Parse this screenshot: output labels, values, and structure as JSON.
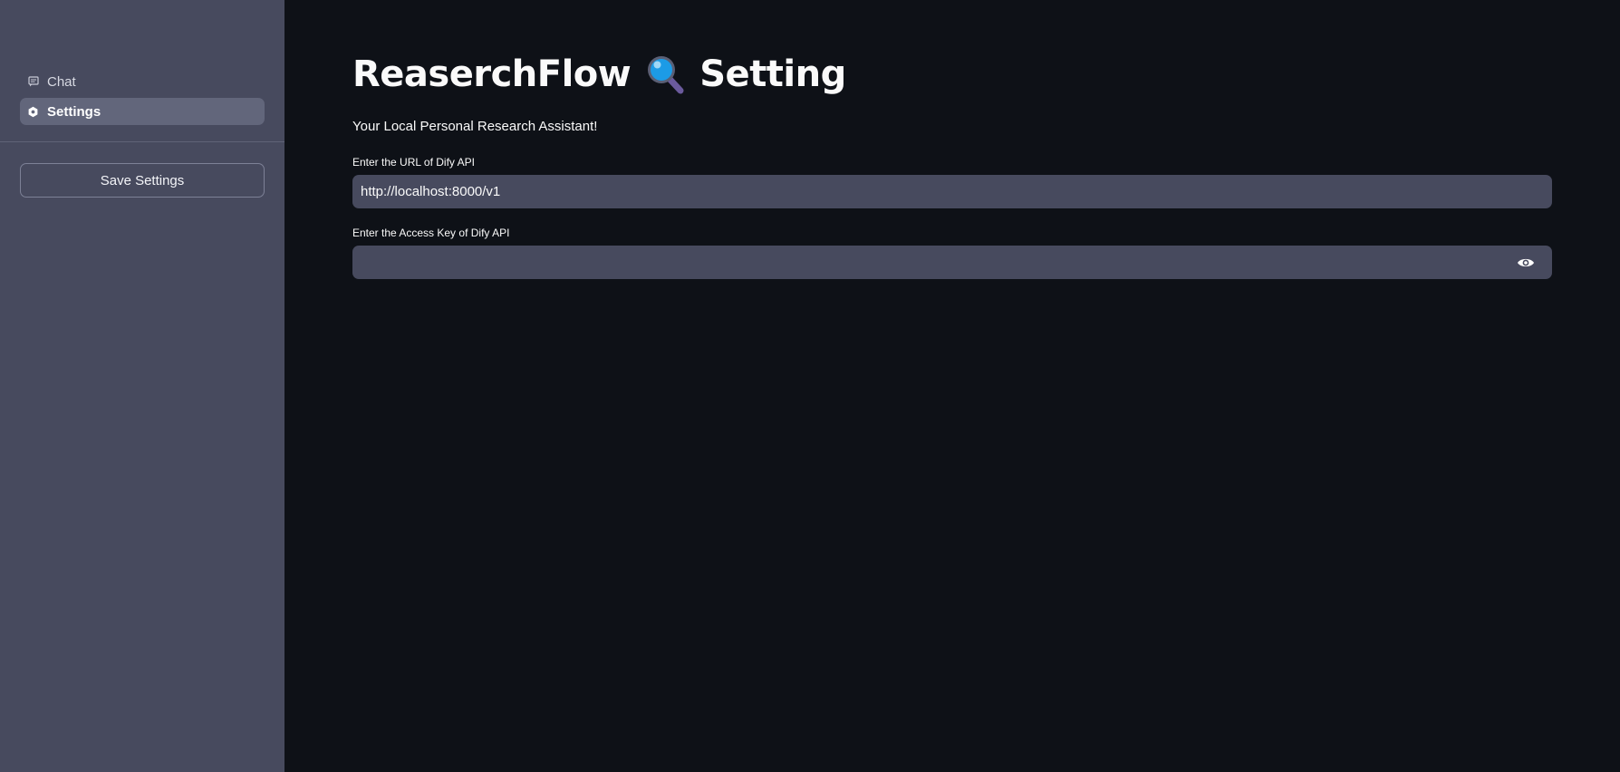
{
  "sidebar": {
    "items": [
      {
        "label": "Chat",
        "icon": "chat-icon",
        "active": false
      },
      {
        "label": "Settings",
        "icon": "settings-gear-icon",
        "active": true
      }
    ],
    "save_button_label": "Save Settings"
  },
  "main": {
    "title_part1": "ReaserchFlow",
    "title_icon": "magnifier-icon",
    "title_part2": "Setting",
    "subtitle": "Your Local Personal Research Assistant!",
    "url_field": {
      "label": "Enter the URL of Dify API",
      "value": "http://localhost:8000/v1"
    },
    "key_field": {
      "label": "Enter the Access Key of Dify API",
      "value": "",
      "reveal_icon": "eye-icon"
    }
  },
  "colors": {
    "sidebar_bg": "#474a5e",
    "main_bg": "#0e1117",
    "input_bg": "#474a5e",
    "active_nav_bg": "#62667b",
    "text": "#fafafa"
  }
}
